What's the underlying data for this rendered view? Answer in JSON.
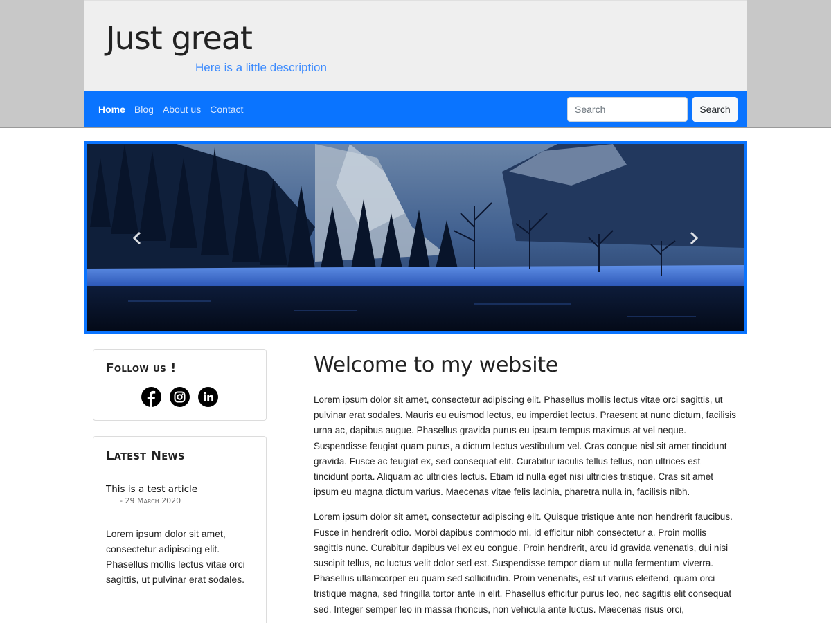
{
  "header": {
    "title": "Just great",
    "description": "Here is a little description"
  },
  "nav": {
    "items": [
      {
        "label": "Home",
        "active": true
      },
      {
        "label": "Blog",
        "active": false
      },
      {
        "label": "About us",
        "active": false
      },
      {
        "label": "Contact",
        "active": false
      }
    ],
    "search": {
      "placeholder": "Search",
      "button_label": "Search"
    }
  },
  "carousel": {
    "prev_icon": "chevron-left-icon",
    "next_icon": "chevron-right-icon"
  },
  "sidebar": {
    "follow": {
      "title": "Follow us !",
      "icons": [
        "facebook-icon",
        "instagram-icon",
        "linkedin-icon"
      ]
    },
    "news": {
      "title": "Latest News",
      "article": {
        "title": "This is a test article",
        "date": "- 29 March 2020",
        "excerpt": "Lorem ipsum dolor sit amet, consectetur adipiscing elit. Phasellus mollis lectus vitae orci sagittis, ut pulvinar erat sodales."
      }
    }
  },
  "main": {
    "heading": "Welcome to my website",
    "paragraphs": [
      "Lorem ipsum dolor sit amet, consectetur adipiscing elit. Phasellus mollis lectus vitae orci sagittis, ut pulvinar erat sodales. Mauris eu euismod lectus, eu imperdiet lectus. Praesent at nunc dictum, facilisis urna ac, dapibus augue. Phasellus gravida purus eu ipsum tempus maximus at vel neque. Suspendisse feugiat quam purus, a dictum lectus vestibulum vel. Cras congue nisl sit amet tincidunt gravida. Fusce ac feugiat ex, sed consequat elit. Curabitur iaculis tellus tellus, non ultrices est tincidunt porta. Aliquam ac ultricies lectus. Etiam id nulla eget nisi ultricies tristique. Cras sit amet ipsum eu magna dictum varius. Maecenas vitae felis lacinia, pharetra nulla in, facilisis nibh.",
      "Lorem ipsum dolor sit amet, consectetur adipiscing elit. Quisque tristique ante non hendrerit faucibus. Fusce in hendrerit odio. Morbi dapibus commodo mi, id efficitur nibh consectetur a. Proin mollis sagittis nunc. Curabitur dapibus vel ex eu congue. Proin hendrerit, arcu id gravida venenatis, dui nisi suscipit tellus, ac luctus velit dolor sed est. Suspendisse tempor diam ut nulla fermentum viverra. Phasellus ullamcorper eu quam sed sollicitudin. Proin venenatis, est ut varius eleifend, quam orci tristique magna, sed fringilla tortor ante in elit. Phasellus efficitur purus leo, nec sagittis elit consequat sed. Integer semper leo in massa rhoncus, non vehicula ante luctus. Maecenas risus orci,"
    ]
  },
  "colors": {
    "accent": "#0a74ff",
    "description": "#3d8bfd",
    "header_bg": "#efefef",
    "band_bg": "#c8c8c8"
  }
}
